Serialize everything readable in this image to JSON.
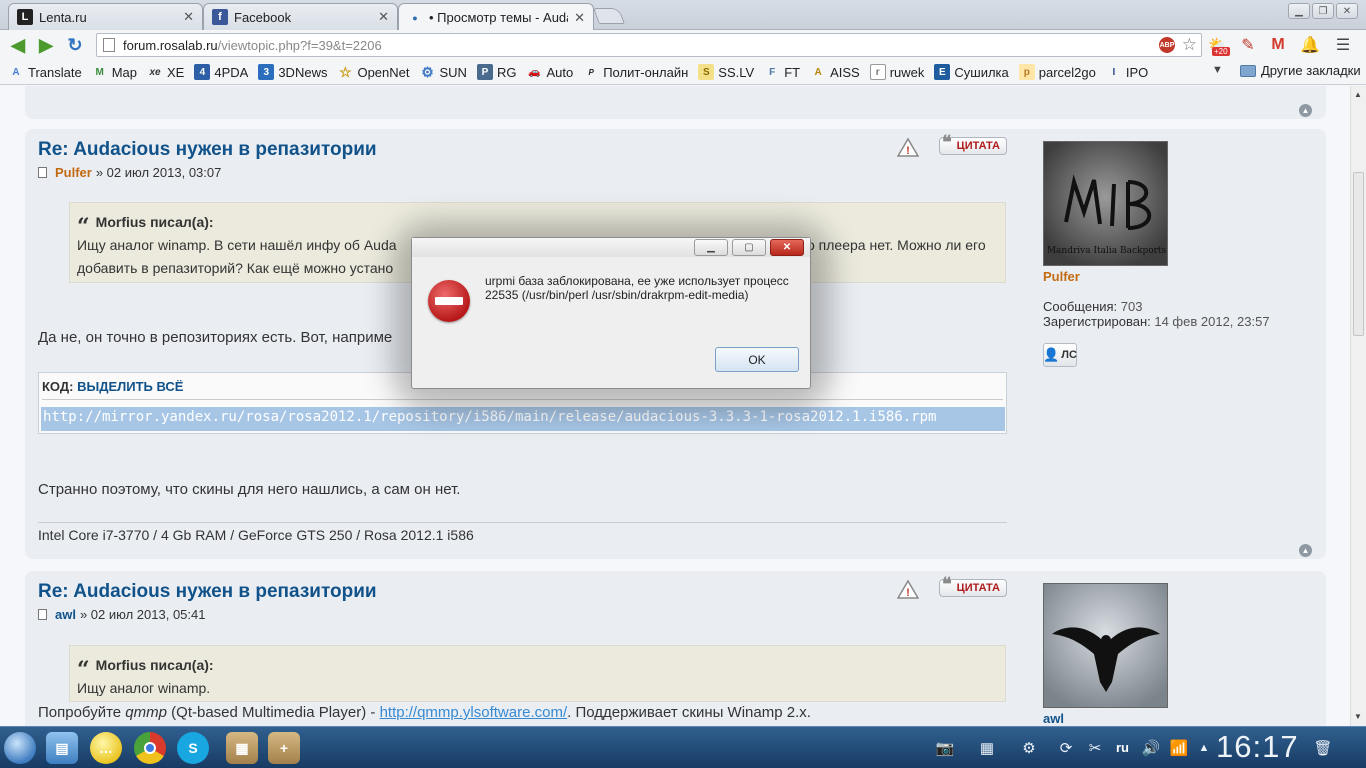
{
  "browser": {
    "tabs": [
      {
        "title": "Lenta.ru",
        "favicon": "L"
      },
      {
        "title": "Facebook",
        "favicon": "f"
      },
      {
        "title": "• Просмотр темы - Audac",
        "favicon": "●"
      }
    ],
    "url_host": "forum.rosalab.ru",
    "url_path": "/viewtopic.php?f=39&t=2206",
    "abp_label": "ABP",
    "ext_badge": "+20",
    "bookmarks": [
      {
        "label": "Translate",
        "icon": "A"
      },
      {
        "label": "Map",
        "icon": "M"
      },
      {
        "label": "XE",
        "icon": "xe"
      },
      {
        "label": "4PDA",
        "icon": "4"
      },
      {
        "label": "3DNews",
        "icon": "3"
      },
      {
        "label": "OpenNet",
        "icon": "☆"
      },
      {
        "label": "SUN",
        "icon": "⚙"
      },
      {
        "label": "RG",
        "icon": "P"
      },
      {
        "label": "Auto",
        "icon": "🚗"
      },
      {
        "label": "Полит-онлайн",
        "icon": "P"
      },
      {
        "label": "SS.LV",
        "icon": "S"
      },
      {
        "label": "FT",
        "icon": "F"
      },
      {
        "label": "AISS",
        "icon": "A"
      },
      {
        "label": "ruwek",
        "icon": "r"
      },
      {
        "label": "Сушилка",
        "icon": "E"
      },
      {
        "label": "parcel2go",
        "icon": "p"
      },
      {
        "label": "IPO",
        "icon": "I"
      }
    ],
    "other_bookmarks": "Другие закладки"
  },
  "posts": [
    {
      "title": "Re: Audacious нужен в репазитории",
      "author": "Pulfer",
      "date": "» 02 июл 2013, 03:07",
      "quote_author": "Morfius писал(а):",
      "quote_line1": "Ищу аналог winamp. В сети нашёл инфу об Auda",
      "quote_line1_end": "о плеера нет. Можно ли его",
      "quote_line2": "добавить в репазиторий? Как ещё можно устано",
      "text1": "Да не, он точно в репозиториях есть. Вот, наприме",
      "code_label": "КОД:",
      "code_select": "ВЫДЕЛИТЬ ВСЁ",
      "code": "http://mirror.yandex.ru/rosa/rosa2012.1/repository/i586/main/release/audacious-3.3.3-1-rosa2012.1.i586.rpm",
      "text2": "Странно поэтому, что скины для него нашлись, а сам он нет.",
      "signature": "Intel Core i7-3770 / 4 Gb RAM / GeForce GTS 250 / Rosa 2012.1 i586",
      "quote_button": "ЦИТАТА",
      "profile": {
        "name": "Pulfer",
        "avatar_text": "Mandriva Italia Backports",
        "posts_label": "Сообщения:",
        "posts": "703",
        "reg_label": "Зарегистрирован:",
        "reg": "14 фев 2012, 23:57",
        "pm_label": "ЛС"
      }
    },
    {
      "title": "Re: Audacious нужен в репазитории",
      "author": "awl",
      "date": "» 02 июл 2013, 05:41",
      "quote_author": "Morfius писал(а):",
      "quote_line1": "Ищу аналог winamp.",
      "text_before": "Попробуйте ",
      "text_em": "qmmp",
      "text_mid": " (Qt-based Multimedia Player) - ",
      "text_link": "http://qmmp.ylsoftware.com/",
      "text_after": ". Поддерживает скины Winamp 2.x.",
      "quote_button": "ЦИТАТА",
      "profile": {
        "name": "awl"
      }
    }
  ],
  "dialog": {
    "message": "urpmi база заблокирована, ее уже использует процесс 22535 (/usr/bin/perl /usr/sbin/drakrpm-edit-media)",
    "ok": "OK"
  },
  "taskbar": {
    "lang": "ru",
    "clock": "16:17"
  },
  "colors": {
    "link": "#105289",
    "author_orange": "#c36a12",
    "quote_red": "#b01c1c"
  }
}
